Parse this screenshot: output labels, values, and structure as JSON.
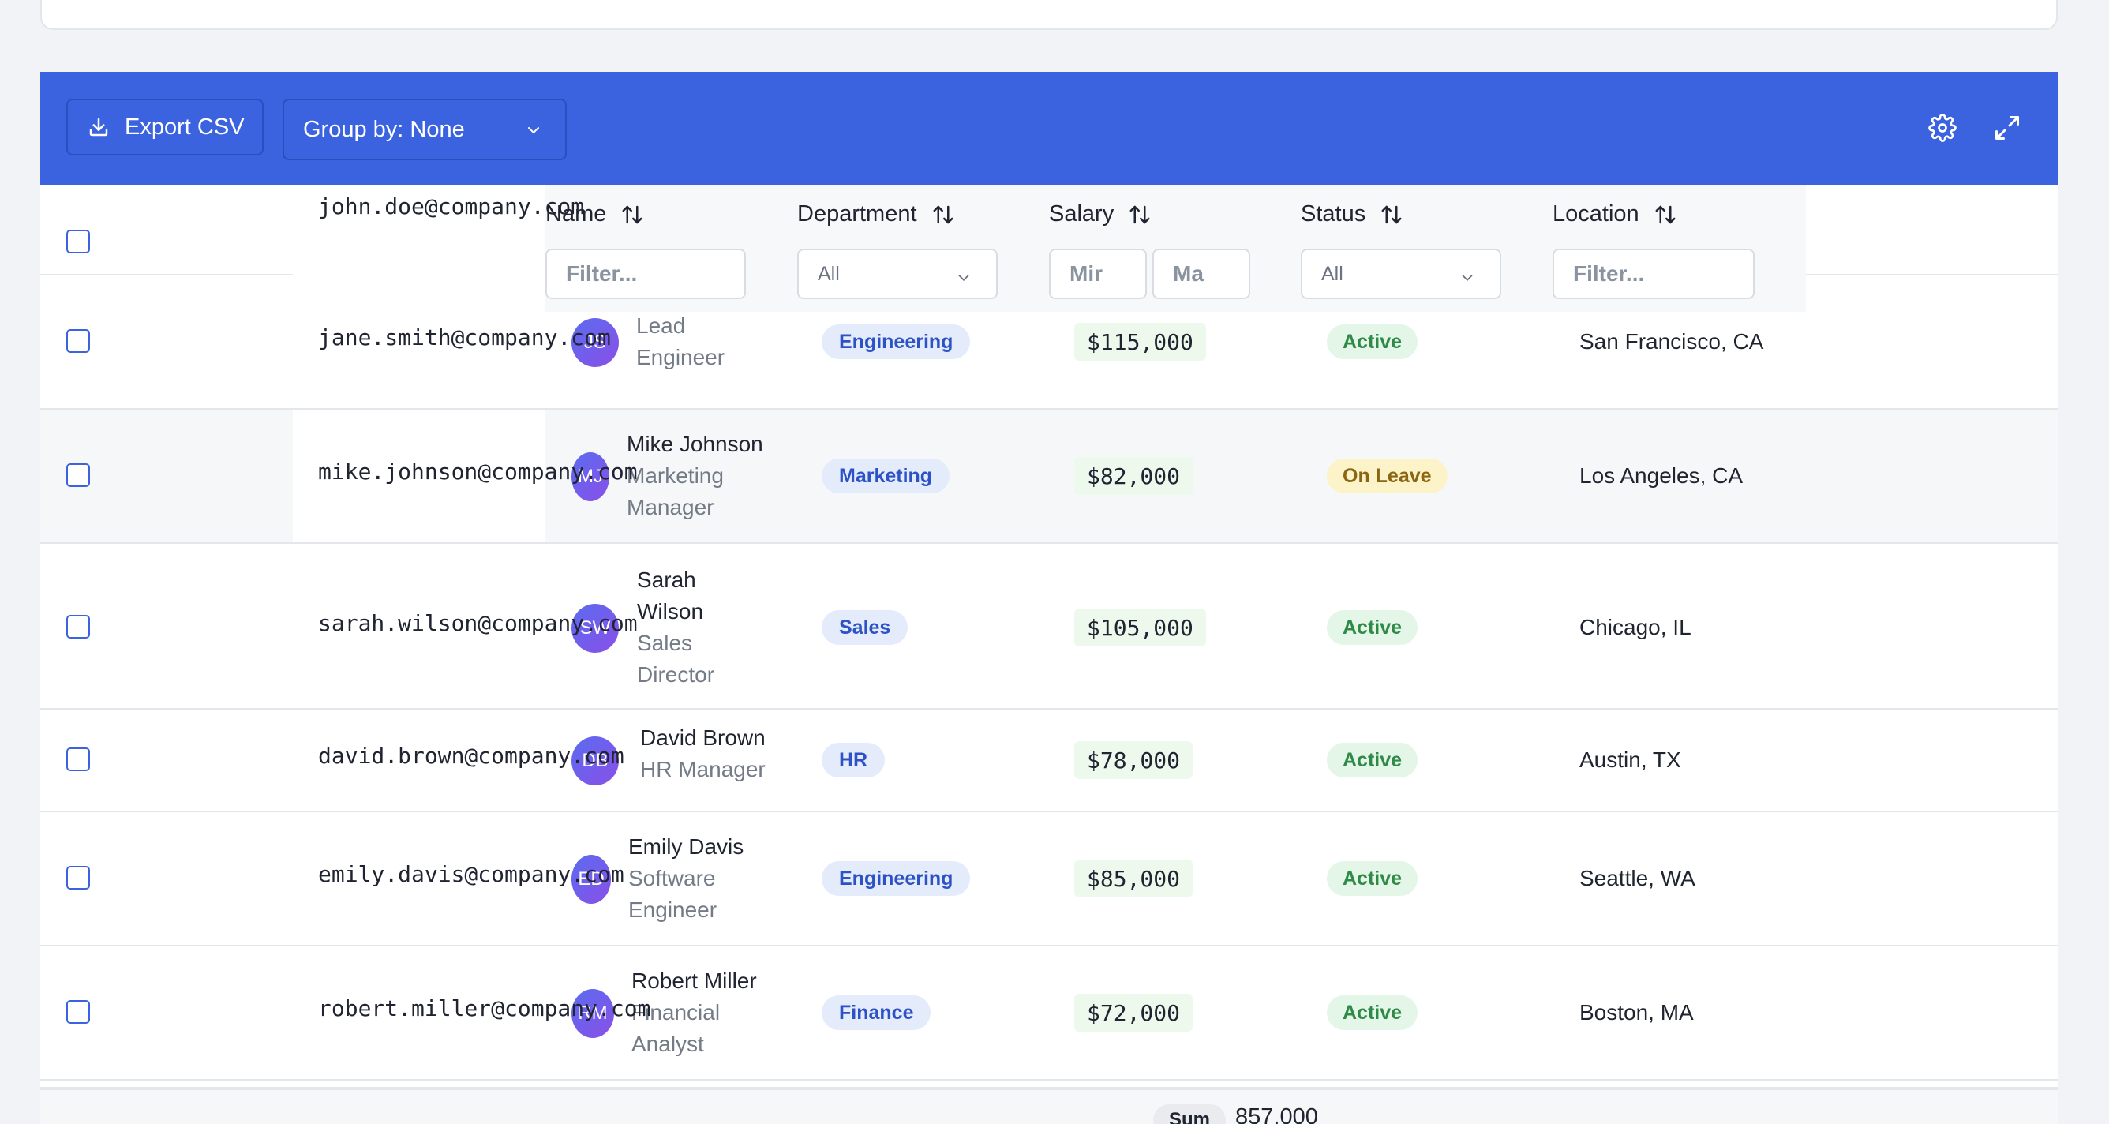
{
  "toolbar": {
    "export_label": "Export CSV",
    "group_by_label": "Group by: None",
    "bg_color": "#3b63e0"
  },
  "header": {
    "email_overlay": "john.doe@company.com",
    "columns": [
      {
        "label": "Name",
        "filter_placeholder": "Filter..."
      },
      {
        "label": "Department",
        "filter_value": "All"
      },
      {
        "label": "Salary",
        "min_placeholder": "Mir",
        "max_placeholder": "Ma"
      },
      {
        "label": "Status",
        "filter_value": "All"
      },
      {
        "label": "Location",
        "filter_placeholder": "Filter..."
      }
    ]
  },
  "rows": [
    {
      "email": "jane.smith@company.com",
      "initials": "JS",
      "name": "",
      "role_l1": "Lead",
      "role_l2": "Engineer",
      "department": "Engineering",
      "salary": "$115,000",
      "status": "Active",
      "location": "San Francisco, CA"
    },
    {
      "email": "mike.johnson@company.com",
      "initials": "MJ",
      "name": "Mike Johnson",
      "role_l1": "Marketing",
      "role_l2": "Manager",
      "department": "Marketing",
      "salary": "$82,000",
      "status": "On Leave",
      "location": "Los Angeles, CA"
    },
    {
      "email": "sarah.wilson@company.com",
      "initials": "SW",
      "name_l1": "Sarah",
      "name_l2": "Wilson",
      "role_l1": "Sales",
      "role_l2": "Director",
      "department": "Sales",
      "salary": "$105,000",
      "status": "Active",
      "location": "Chicago, IL"
    },
    {
      "email": "david.brown@company.com",
      "initials": "DB",
      "name": "David Brown",
      "role_l1": "HR Manager",
      "department": "HR",
      "salary": "$78,000",
      "status": "Active",
      "location": "Austin, TX"
    },
    {
      "email": "emily.davis@company.com",
      "initials": "ED",
      "name": "Emily Davis",
      "role_l1": "Software",
      "role_l2": "Engineer",
      "department": "Engineering",
      "salary": "$85,000",
      "status": "Active",
      "location": "Seattle, WA"
    },
    {
      "email": "robert.miller@company.com",
      "initials": "RM",
      "name": "Robert Miller",
      "role_l1": "Financial",
      "role_l2": "Analyst",
      "department": "Finance",
      "salary": "$72,000",
      "status": "Active",
      "location": "Boston, MA"
    }
  ],
  "footer": {
    "sum_label": "Sum",
    "sum_value": "857,000"
  }
}
